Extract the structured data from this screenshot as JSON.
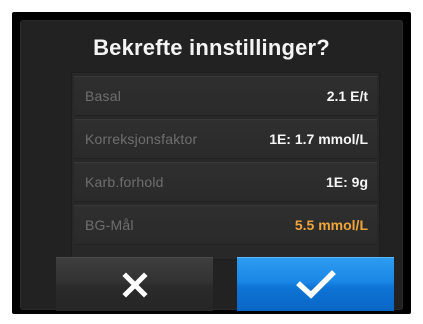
{
  "dialog": {
    "title": "Bekrefte innstillinger?"
  },
  "settings": [
    {
      "label": "Basal",
      "value": "2.1 E/t",
      "highlight": false
    },
    {
      "label": "Korreksjonsfaktor",
      "value": "1E: 1.7 mmol/L",
      "highlight": false
    },
    {
      "label": "Karb.forhold",
      "value": "1E: 9g",
      "highlight": false
    },
    {
      "label": "BG-Mål",
      "value": "5.5 mmol/L",
      "highlight": true
    }
  ],
  "buttons": {
    "cancel_icon": "close-icon",
    "confirm_icon": "checkmark-icon"
  },
  "colors": {
    "highlight_value": "#f0a53a",
    "confirm_button": "#1a86e6"
  }
}
